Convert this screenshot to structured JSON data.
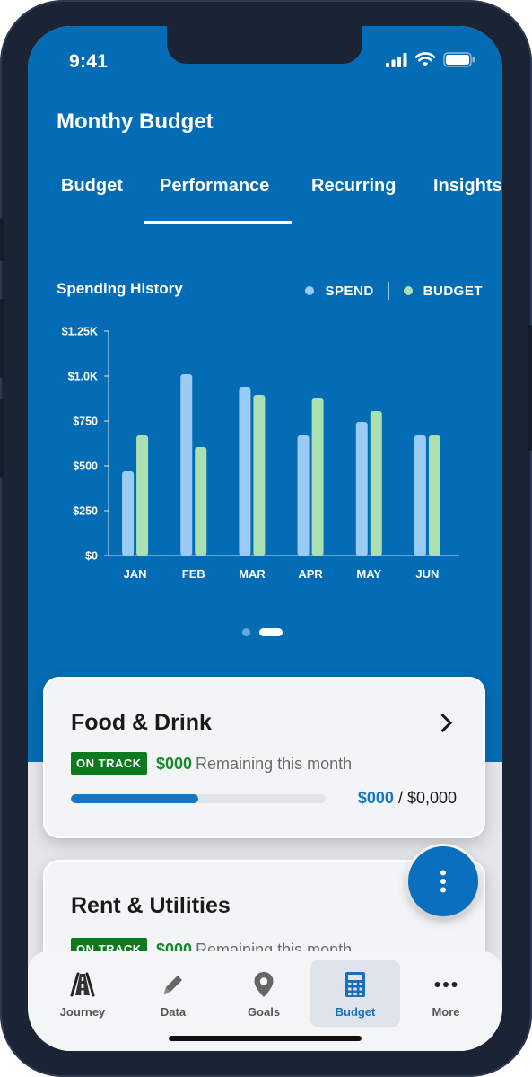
{
  "status": {
    "time": "9:41"
  },
  "header": {
    "title": "Monthy Budget"
  },
  "tabs": [
    {
      "label": "Budget"
    },
    {
      "label": "Performance",
      "active": true
    },
    {
      "label": "Recurring"
    },
    {
      "label": "Insights"
    }
  ],
  "chart_section": {
    "title": "Spending History",
    "legend": {
      "spend": "SPEND",
      "budget": "BUDGET"
    }
  },
  "chart_data": {
    "type": "bar",
    "title": "Spending History",
    "categories": [
      "JAN",
      "FEB",
      "MAR",
      "APR",
      "MAY",
      "JUN"
    ],
    "series": [
      {
        "name": "SPEND",
        "values": [
          470,
          1010,
          940,
          670,
          745,
          670
        ],
        "color": "#99cbf4"
      },
      {
        "name": "BUDGET",
        "values": [
          670,
          605,
          895,
          875,
          805,
          670
        ],
        "color": "#abe0b3"
      }
    ],
    "y_ticks": [
      "$0",
      "$250",
      "$500",
      "$750",
      "$1.0K",
      "$1.25K"
    ],
    "ylim": [
      0,
      1250
    ],
    "grid": false,
    "legend_position": "top-right"
  },
  "pager": {
    "count": 2,
    "active": 1
  },
  "cards": [
    {
      "name": "Food & Drink",
      "badge": "ON TRACK",
      "remaining_amount": "$000",
      "remaining_text": "Remaining this month",
      "spent": "$000",
      "total": " / $0,000",
      "progress": 0.5
    },
    {
      "name": "Rent & Utilities",
      "badge": "ON TRACK",
      "remaining_amount": "$000",
      "remaining_text": "Remaining this month"
    }
  ],
  "nav": [
    {
      "label": "Journey",
      "icon": "road-icon"
    },
    {
      "label": "Data",
      "icon": "pencil-icon"
    },
    {
      "label": "Goals",
      "icon": "location-pin-icon"
    },
    {
      "label": "Budget",
      "icon": "calculator-icon",
      "active": true
    },
    {
      "label": "More",
      "icon": "more-dots-icon"
    }
  ],
  "colors": {
    "primary_blue": "#036cb4",
    "spend_bar": "#99cbf4",
    "budget_bar": "#abe0b3",
    "on_track_green": "#0d7a1d",
    "progress_blue": "#1776c3"
  }
}
